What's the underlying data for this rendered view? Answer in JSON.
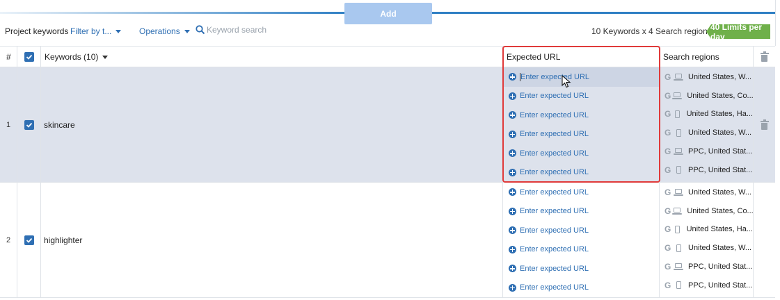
{
  "add_button": "Add",
  "toolbar": {
    "title": "Project keywords",
    "filter_label": "Filter by t...",
    "operations_label": "Operations",
    "search_placeholder": "Keyword search",
    "summary": "10 Keywords x 4 Search regions =",
    "limits_badge": "40 Limits per day",
    "badge_color": "#6fb04a",
    "accent_color": "#2f6fb3"
  },
  "table": {
    "headers": {
      "num": "#",
      "keywords": "Keywords (10)",
      "expected_url": "Expected URL",
      "search_regions": "Search regions"
    },
    "rows": [
      {
        "num": "1",
        "keyword": "skincare",
        "checked": true,
        "selected": true,
        "urls": [
          "Enter expected URL",
          "Enter expected URL",
          "Enter expected URL",
          "Enter expected URL",
          "Enter expected URL",
          "Enter expected URL"
        ],
        "regions": [
          {
            "device": "laptop-icon",
            "label": "United States, W..."
          },
          {
            "device": "laptop-icon",
            "label": "United States, Co..."
          },
          {
            "device": "phone-icon",
            "label": "United States, Ha..."
          },
          {
            "device": "phone-icon",
            "label": "United States, W..."
          },
          {
            "device": "laptop-icon",
            "label": "PPC, United Stat..."
          },
          {
            "device": "phone-icon",
            "label": "PPC, United Stat..."
          }
        ]
      },
      {
        "num": "2",
        "keyword": "highlighter",
        "checked": true,
        "selected": false,
        "urls": [
          "Enter expected URL",
          "Enter expected URL",
          "Enter expected URL",
          "Enter expected URL",
          "Enter expected URL",
          "Enter expected URL"
        ],
        "regions": [
          {
            "device": "laptop-icon",
            "label": "United States, W..."
          },
          {
            "device": "laptop-icon",
            "label": "United States, Co..."
          },
          {
            "device": "phone-icon",
            "label": "United States, Ha..."
          },
          {
            "device": "phone-icon",
            "label": "United States, W..."
          },
          {
            "device": "laptop-icon",
            "label": "PPC, United Stat..."
          },
          {
            "device": "phone-icon",
            "label": "PPC, United Stat..."
          }
        ]
      }
    ]
  }
}
